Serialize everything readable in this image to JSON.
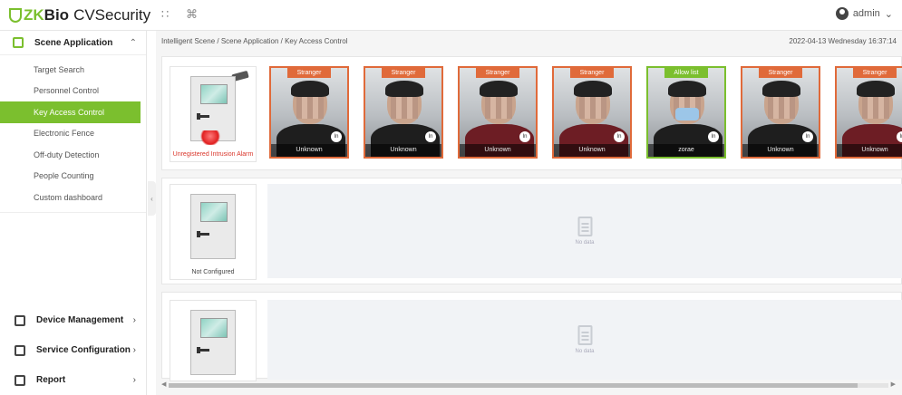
{
  "app": {
    "logo_zk": "ZK",
    "logo_bio": "Bio",
    "logo_product": "CVSecurity"
  },
  "topbar": {
    "user": "admin",
    "user_caret": "⌄"
  },
  "sidebar": {
    "section_title": "Scene Application",
    "items": [
      {
        "label": "Target Search"
      },
      {
        "label": "Personnel Control"
      },
      {
        "label": "Key Access Control",
        "active": true
      },
      {
        "label": "Electronic Fence"
      },
      {
        "label": "Off-duty Detection"
      },
      {
        "label": "People Counting"
      },
      {
        "label": "Custom dashboard"
      }
    ],
    "bottom": [
      {
        "label": "Device Management"
      },
      {
        "label": "Service Configuration"
      },
      {
        "label": "Report"
      }
    ]
  },
  "main": {
    "breadcrumb": "Intelligent Scene / Scene Application / Key Access Control",
    "datetime": "2022-04-13 Wednesday 16:37:14",
    "row1": {
      "door_label": "Unregistered Intrusion Alarm",
      "faces": [
        {
          "tag": "Stranger",
          "name": "Unknown",
          "dir": "In",
          "allow": false
        },
        {
          "tag": "Stranger",
          "name": "Unknown",
          "dir": "In",
          "allow": false
        },
        {
          "tag": "Stranger",
          "name": "Unknown",
          "dir": "In",
          "allow": false
        },
        {
          "tag": "Stranger",
          "name": "Unknown",
          "dir": "In",
          "allow": false
        },
        {
          "tag": "Allow list",
          "name": "zorae",
          "dir": "In",
          "allow": true
        },
        {
          "tag": "Stranger",
          "name": "Unknown",
          "dir": "In",
          "allow": false
        },
        {
          "tag": "Stranger",
          "name": "Unknown",
          "dir": "In",
          "allow": false
        }
      ]
    },
    "row2": {
      "door_label": "Not Configured",
      "empty": "No data"
    },
    "row3": {
      "empty": "No data"
    }
  }
}
